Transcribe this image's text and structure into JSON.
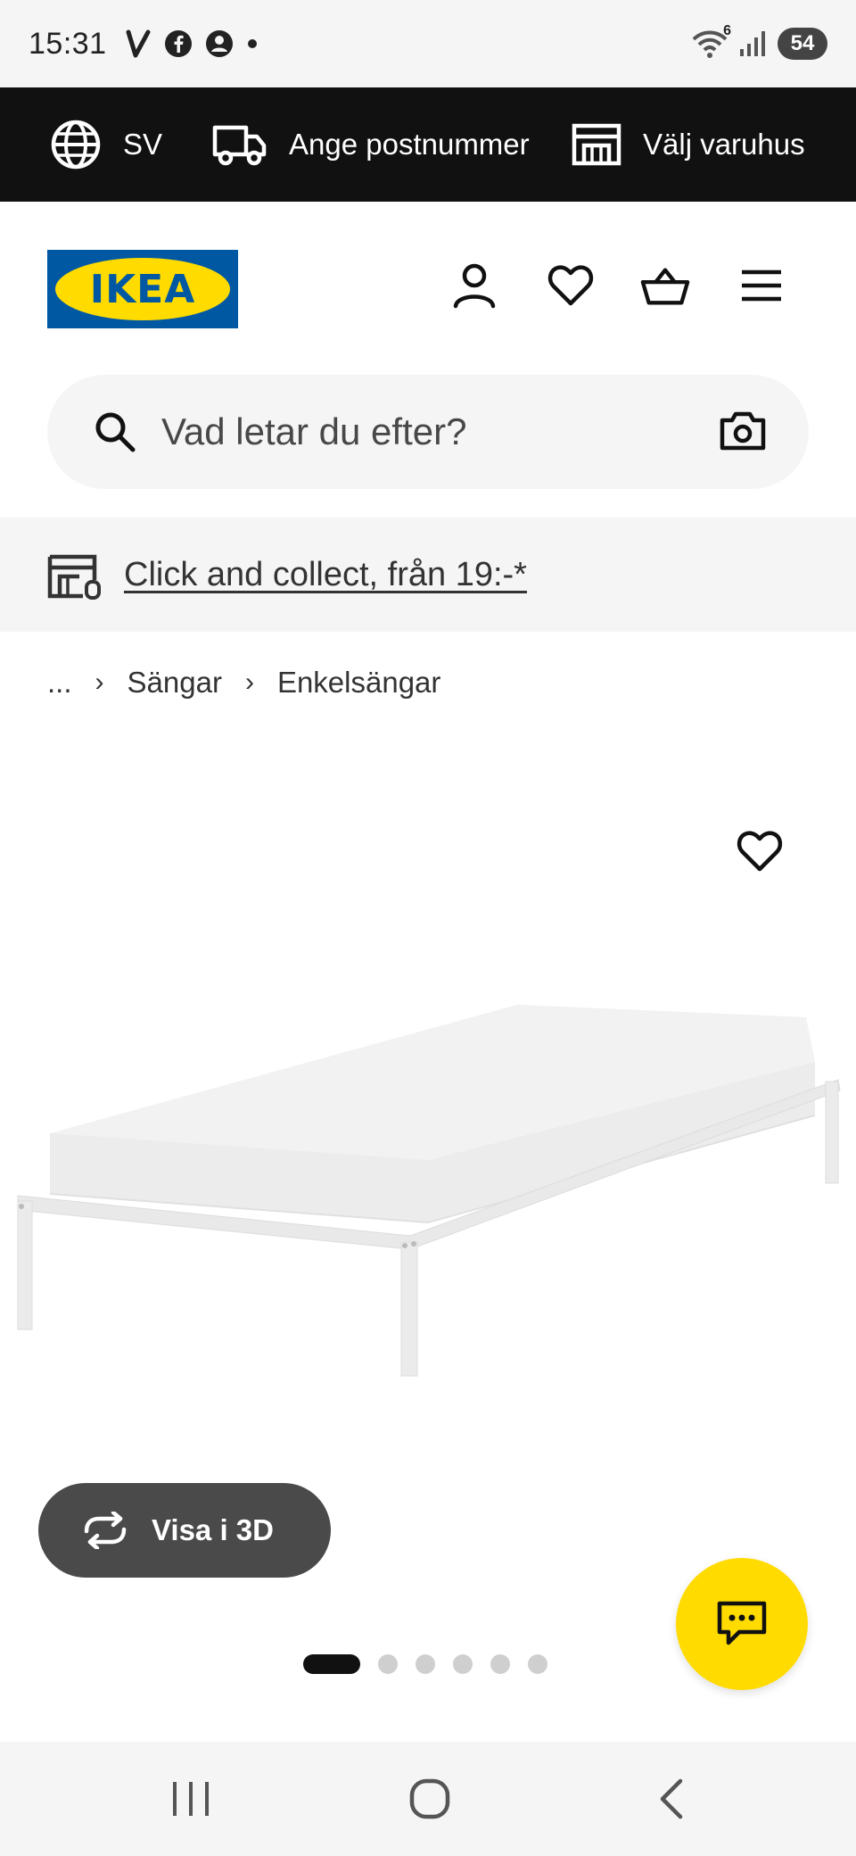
{
  "status_bar": {
    "time": "15:31",
    "battery": "54",
    "wifi_badge": "6"
  },
  "top_strip": {
    "language": "SV",
    "postcode": "Ange postnummer",
    "store": "Välj varuhus"
  },
  "header": {
    "logo_text": "IKEA"
  },
  "search": {
    "placeholder": "Vad letar du efter?"
  },
  "click_collect": {
    "text": "Click and collect, från 19:-*"
  },
  "breadcrumb": {
    "ellipsis": "...",
    "items": [
      "Sängar",
      "Enkelsängar"
    ]
  },
  "gallery": {
    "view_3d_label": "Visa i 3D",
    "slide_count": 6,
    "active_slide": 1
  },
  "colors": {
    "brand_blue": "#0058a3",
    "brand_yellow": "#ffdb00",
    "dark": "#111111"
  }
}
